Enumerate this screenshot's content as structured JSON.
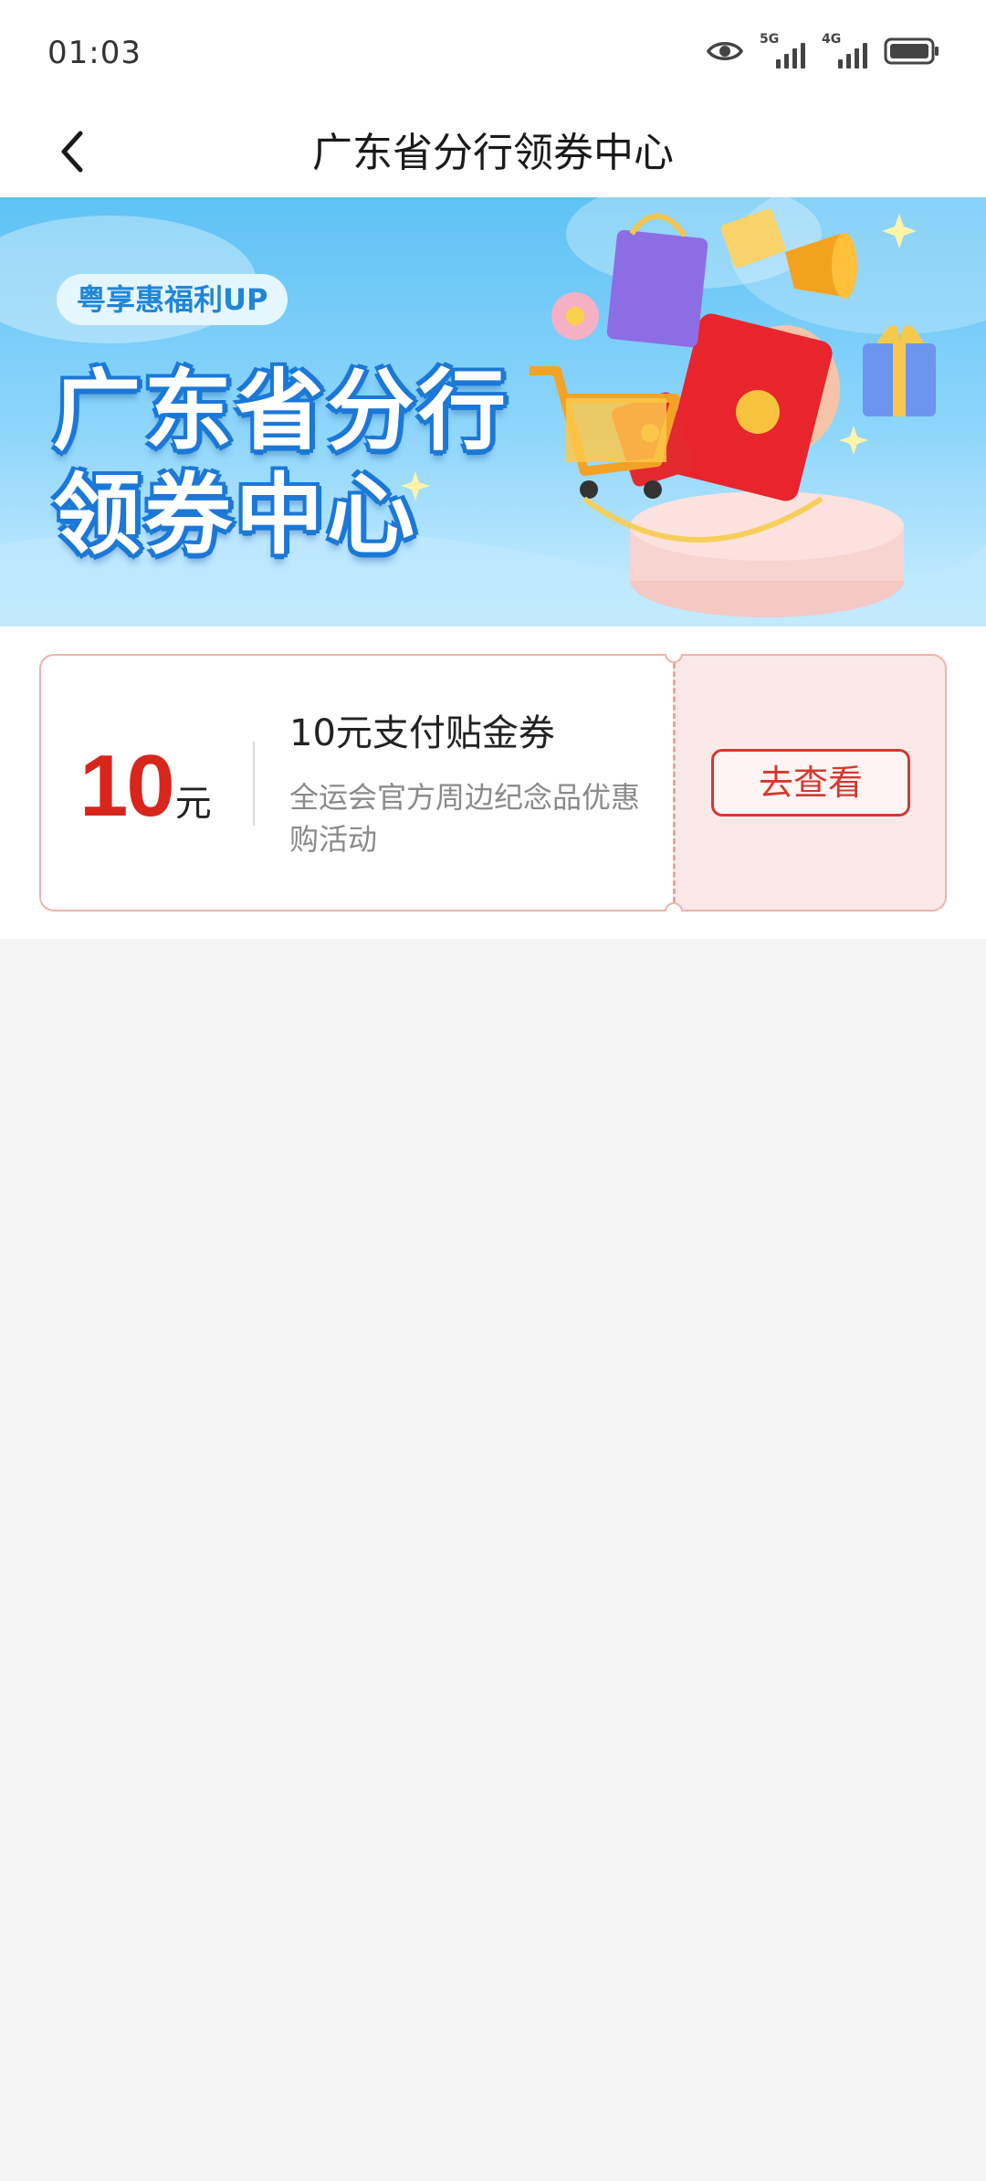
{
  "status_bar": {
    "time": "01:03",
    "icons": [
      "eye-icon",
      "signal-5g-icon",
      "signal-4g-icon",
      "battery-icon"
    ],
    "signal_labels": [
      "5G",
      "4G"
    ]
  },
  "nav": {
    "title": "广东省分行领券中心",
    "back_icon": "chevron-left-icon"
  },
  "banner": {
    "tag": "粤享惠福利UP",
    "headline_line1": "广东省分行",
    "headline_line2": "领券中心"
  },
  "coupons": [
    {
      "amount": "10",
      "unit": "元",
      "title": "10元支付贴金券",
      "description": "全运会官方周边纪念品优惠购活动",
      "action_label": "去查看"
    }
  ],
  "colors": {
    "accent_red": "#d8261c",
    "coupon_border": "#f1b3a9",
    "coupon_right_bg": "#fbe9e9",
    "page_bg": "#f5f5f5",
    "banner_blue": "#5fc2f5"
  }
}
